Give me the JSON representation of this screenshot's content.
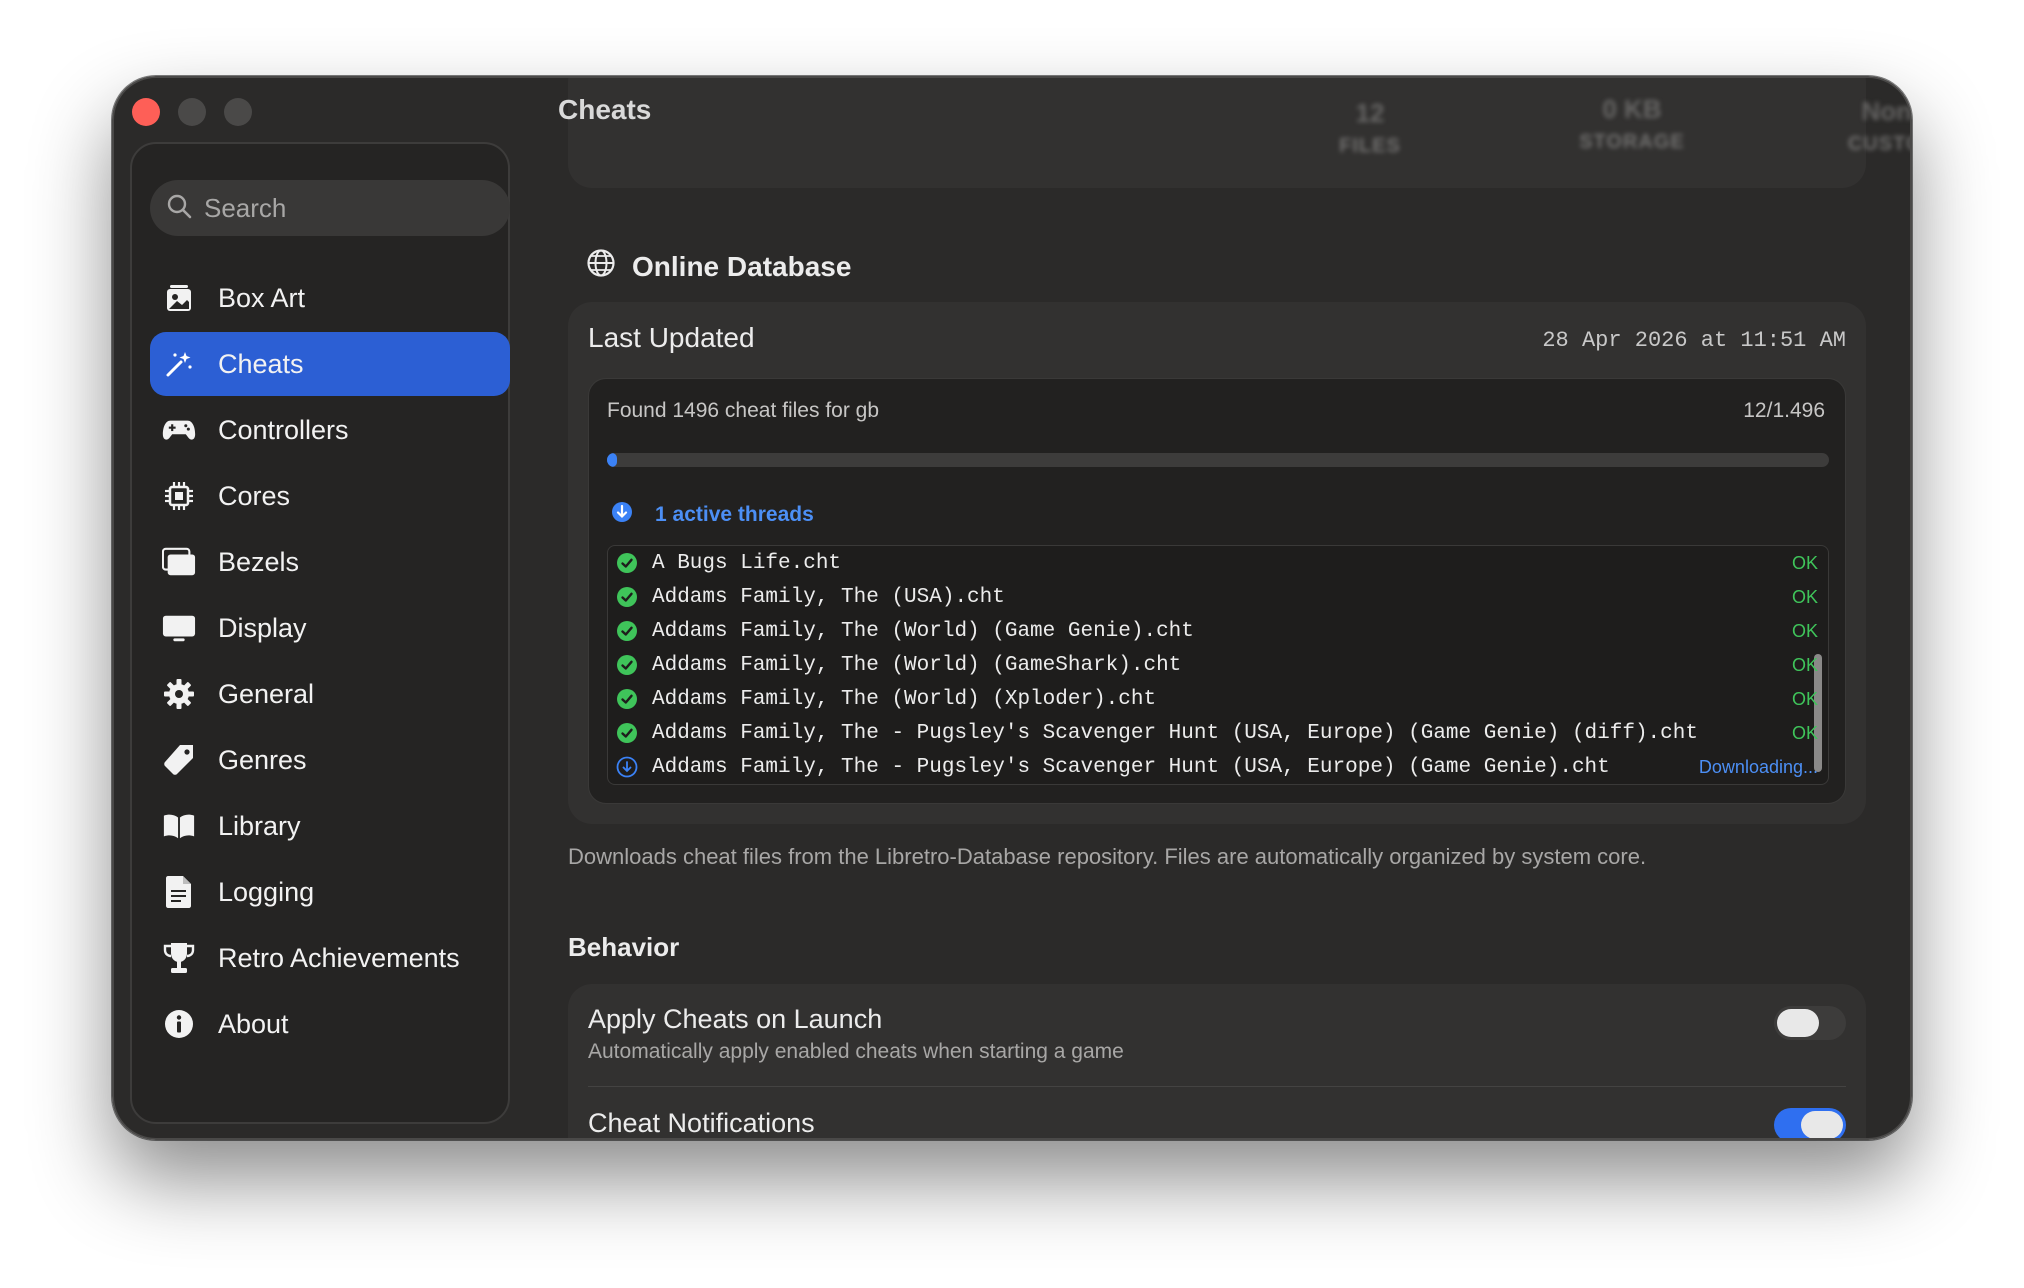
{
  "window": {
    "title": "Cheats"
  },
  "search": {
    "placeholder": "Search"
  },
  "sidebar": {
    "items": [
      {
        "label": "Box Art",
        "icon": "box-art-icon",
        "active": false
      },
      {
        "label": "Cheats",
        "icon": "magic-wand-icon",
        "active": true
      },
      {
        "label": "Controllers",
        "icon": "gamepad-icon",
        "active": false
      },
      {
        "label": "Cores",
        "icon": "cpu-icon",
        "active": false
      },
      {
        "label": "Bezels",
        "icon": "bezels-icon",
        "active": false
      },
      {
        "label": "Display",
        "icon": "display-icon",
        "active": false
      },
      {
        "label": "General",
        "icon": "gear-icon",
        "active": false
      },
      {
        "label": "Genres",
        "icon": "tag-icon",
        "active": false
      },
      {
        "label": "Library",
        "icon": "book-icon",
        "active": false
      },
      {
        "label": "Logging",
        "icon": "document-icon",
        "active": false
      },
      {
        "label": "Retro Achievements",
        "icon": "trophy-icon",
        "active": false
      },
      {
        "label": "About",
        "icon": "info-icon",
        "active": false
      }
    ]
  },
  "stats": [
    {
      "value": "12",
      "label": "FILES"
    },
    {
      "value": "0 KB",
      "label": "STORAGE"
    },
    {
      "value": "None",
      "label": "CUSTOM"
    }
  ],
  "online_database": {
    "heading": "Online Database",
    "last_updated_label": "Last Updated",
    "last_updated_value": "28 Apr 2026 at 11:51 AM",
    "found_text": "Found 1496 cheat files for gb",
    "counter": "12/1.496",
    "progress": 0.008,
    "threads_text": "1 active threads",
    "files": [
      {
        "name": "A Bugs Life.cht",
        "status": "OK",
        "state": "done"
      },
      {
        "name": "Addams Family, The (USA).cht",
        "status": "OK",
        "state": "done"
      },
      {
        "name": "Addams Family, The (World) (Game Genie).cht",
        "status": "OK",
        "state": "done"
      },
      {
        "name": "Addams Family, The (World) (GameShark).cht",
        "status": "OK",
        "state": "done"
      },
      {
        "name": "Addams Family, The (World) (Xploder).cht",
        "status": "OK",
        "state": "done"
      },
      {
        "name": "Addams Family, The - Pugsley's Scavenger Hunt (USA, Europe) (Game Genie) (diff).cht",
        "status": "OK",
        "state": "done"
      },
      {
        "name": "Addams Family, The - Pugsley's Scavenger Hunt (USA, Europe) (Game Genie).cht",
        "status": "Downloading...",
        "state": "downloading"
      }
    ],
    "description": "Downloads cheat files from the Libretro-Database repository. Files are automatically organized by system core."
  },
  "behavior": {
    "heading": "Behavior",
    "settings": [
      {
        "title": "Apply Cheats on Launch",
        "subtitle": "Automatically apply enabled cheats when starting a game",
        "enabled": false
      },
      {
        "title": "Cheat Notifications",
        "subtitle": "",
        "enabled": true
      }
    ]
  },
  "colors": {
    "accent": "#2c5fd4",
    "ok": "#3fc45a",
    "link": "#4c8ff5",
    "close": "#fe5f57"
  }
}
